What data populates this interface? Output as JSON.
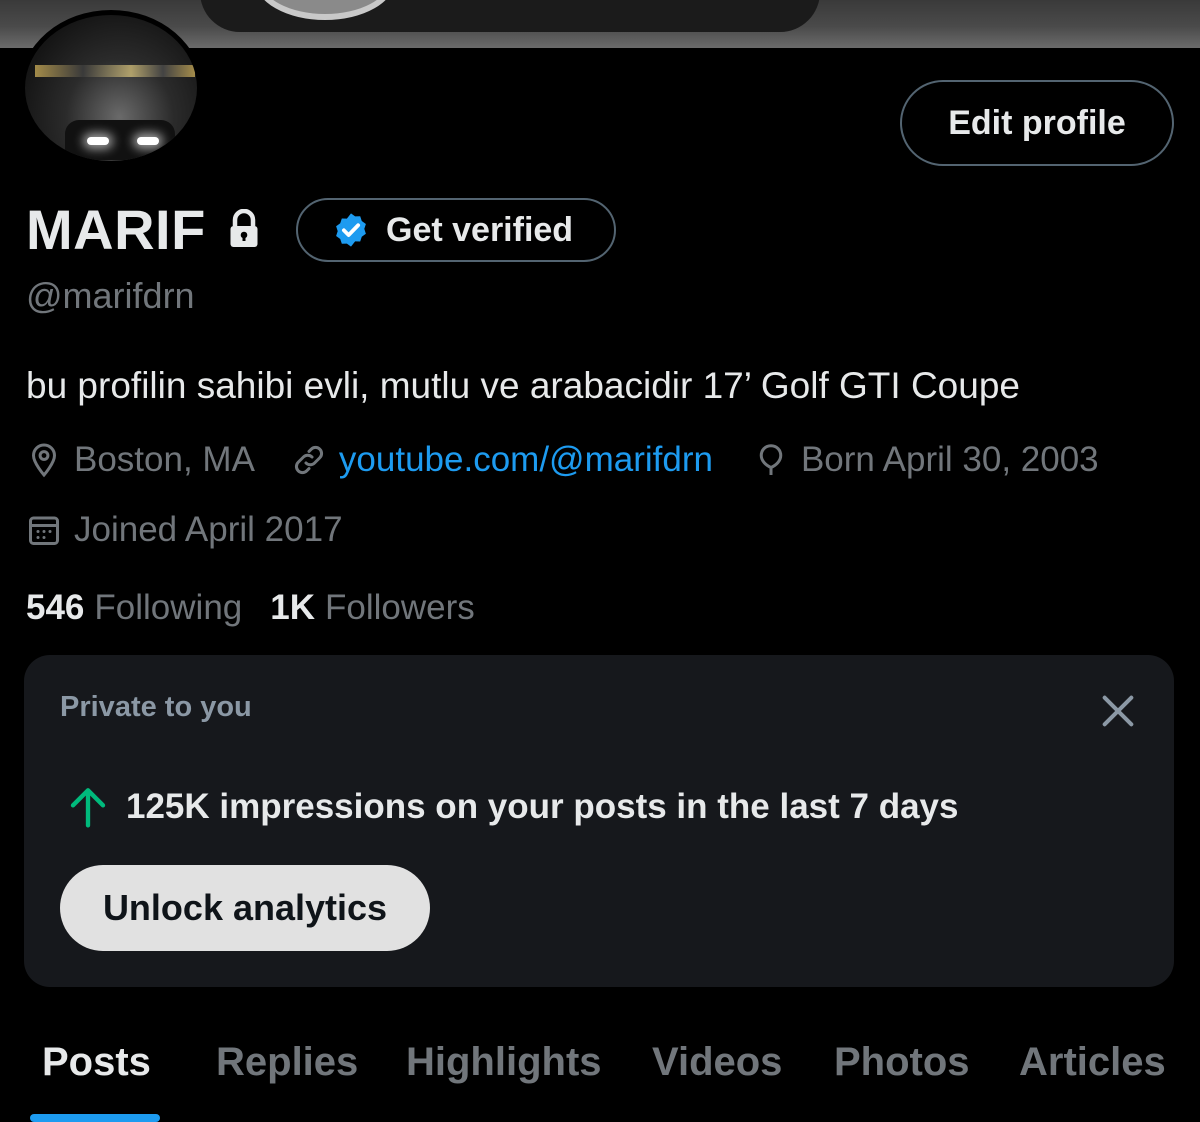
{
  "profile": {
    "display_name": "MARIF",
    "handle": "@marifdrn",
    "bio": "bu profilin sahibi evli, mutlu ve arabacidir 17’ Golf GTI Coupe",
    "edit_label": "Edit profile",
    "verify_label": "Get verified",
    "location": "Boston, MA",
    "website": "youtube.com/@marifdrn",
    "birthday": "Born April 30, 2003",
    "joined": "Joined April 2017"
  },
  "stats": {
    "following_count": "546",
    "following_label": "Following",
    "followers_count": "1K",
    "followers_label": "Followers"
  },
  "private_card": {
    "title": "Private to you",
    "impressions_text": "125K impressions on your posts in the last 7 days",
    "unlock_label": "Unlock analytics"
  },
  "tabs": [
    {
      "label": "Posts"
    },
    {
      "label": "Replies"
    },
    {
      "label": "Highlights"
    },
    {
      "label": "Videos"
    },
    {
      "label": "Photos"
    },
    {
      "label": "Articles"
    }
  ],
  "colors": {
    "accent": "#1d9bf0",
    "muted_text": "#71767b",
    "card_bg": "#16181c",
    "impressions_arrow": "#00ba7c"
  },
  "icons": [
    "lock-icon",
    "verified-badge-icon",
    "location-icon",
    "link-icon",
    "birthday-icon",
    "calendar-icon",
    "close-icon",
    "arrow-up-icon"
  ]
}
